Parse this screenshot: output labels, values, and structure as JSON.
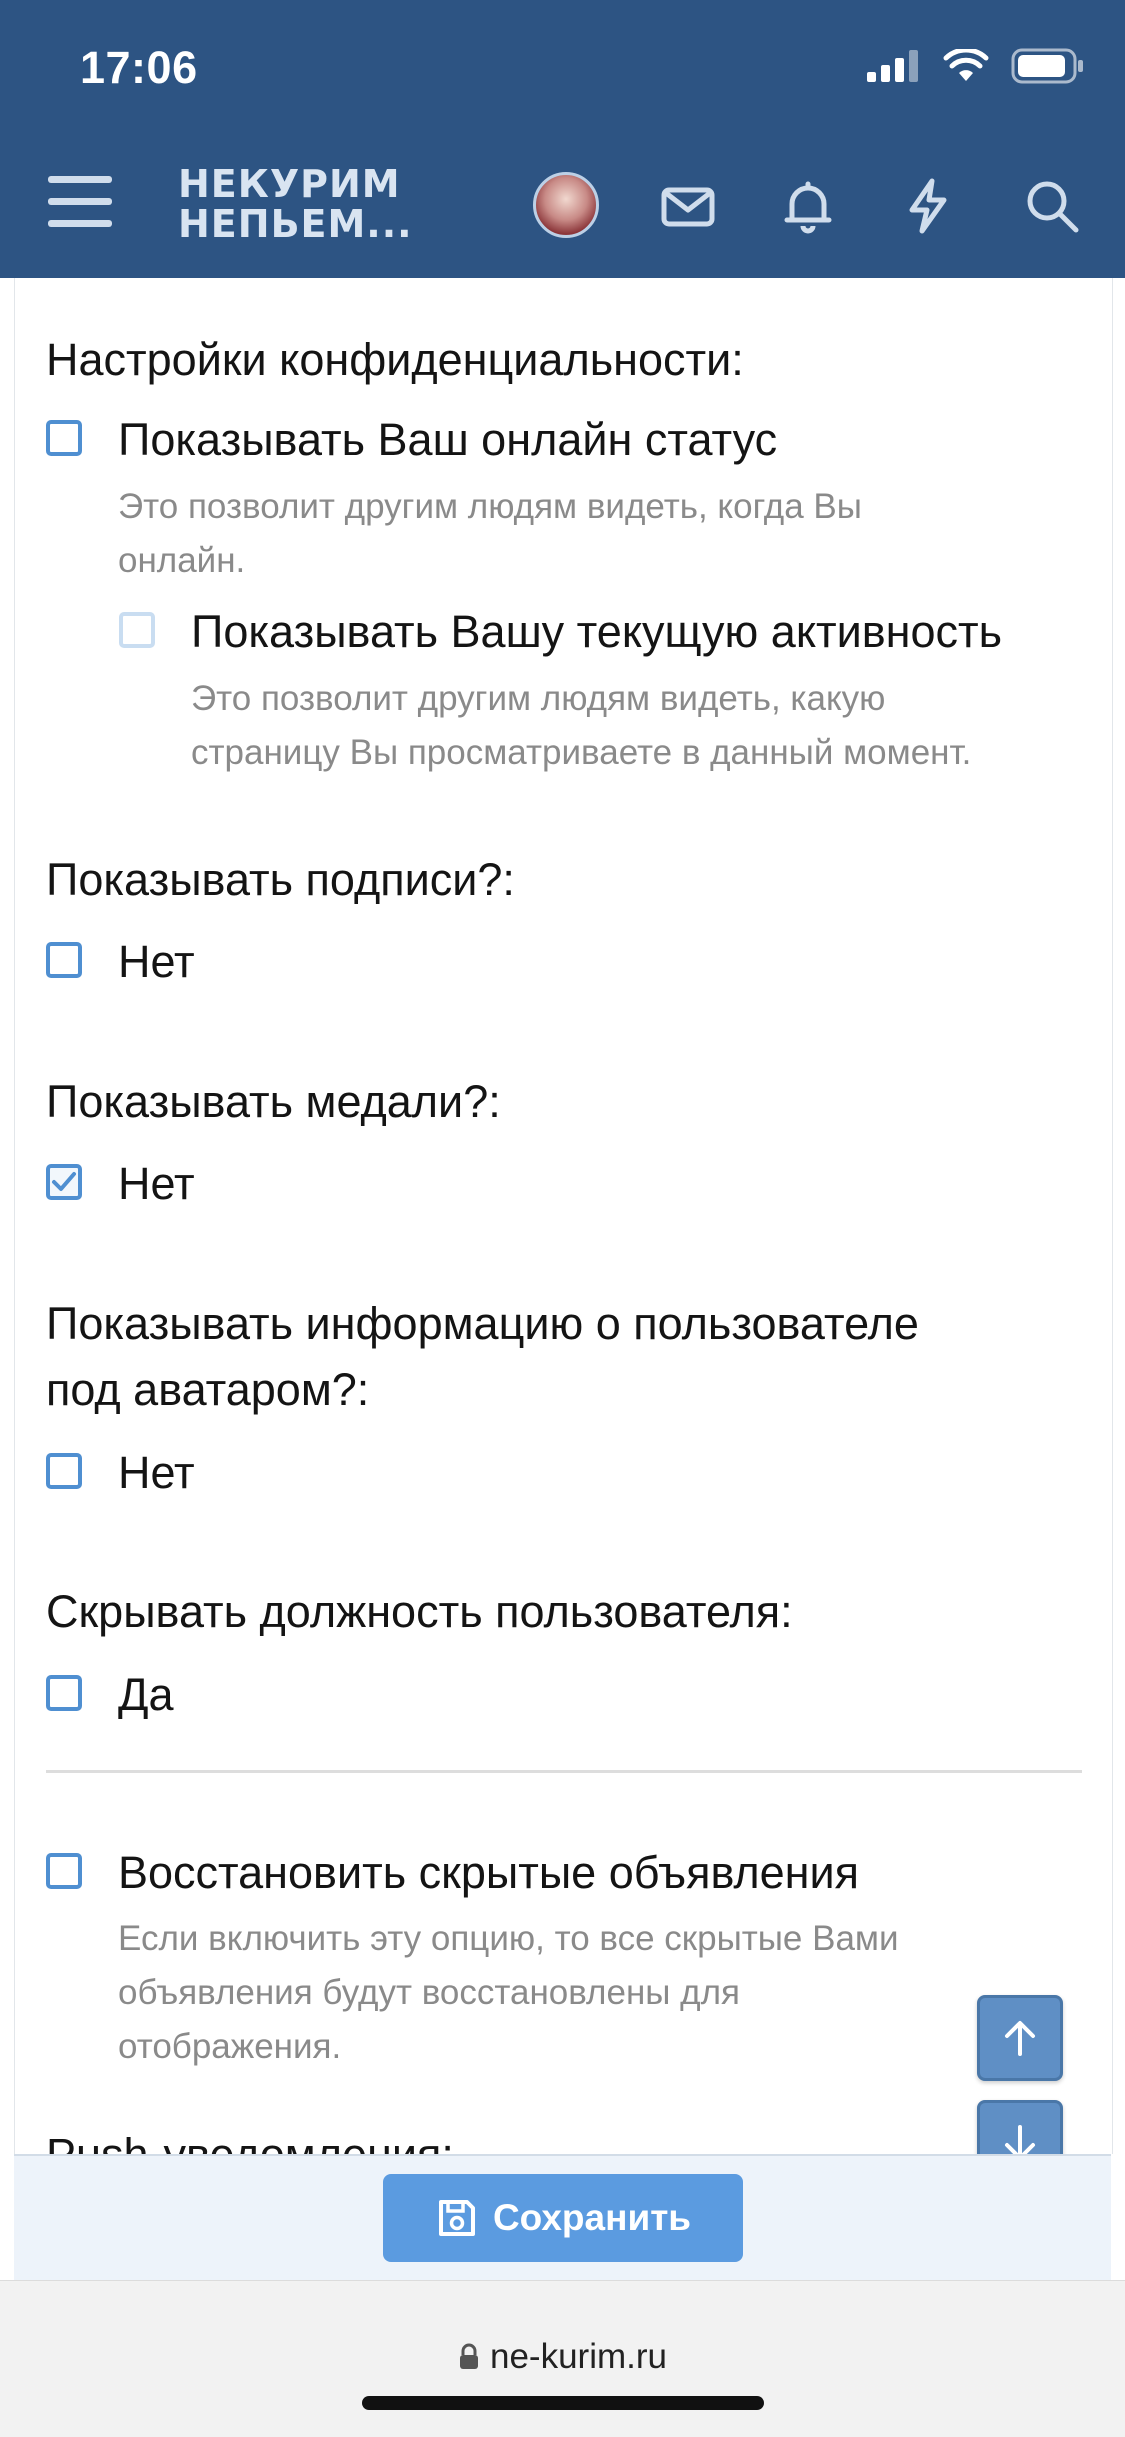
{
  "status_bar": {
    "time": "17:06"
  },
  "header": {
    "logo_line1": "НЕКУРИМ",
    "logo_line2": "НЕПЬЕМ...",
    "icons": [
      "menu-icon",
      "avatar",
      "mail-icon",
      "bell-icon",
      "bolt-icon",
      "search-icon"
    ]
  },
  "privacy": {
    "heading": "Настройки конфиденциальности:",
    "online_status": {
      "label": "Показывать Ваш онлайн статус",
      "hint1": "Это позволит другим людям видеть, когда Вы",
      "hint2": "онлайн.",
      "checked": false
    },
    "activity": {
      "label": "Показывать Вашу текущую активность",
      "hint1": "Это позволит другим людям видеть, какую",
      "hint2": "страницу Вы просматриваете в данный момент.",
      "checked": false,
      "disabled": true
    }
  },
  "signatures": {
    "heading": "Показывать подписи?:",
    "option": "Нет",
    "checked": false
  },
  "medals": {
    "heading": "Показывать медали?:",
    "option": "Нет",
    "checked": true
  },
  "user_info": {
    "heading1": "Показывать информацию о пользователе",
    "heading2": "под аватаром?:",
    "option": "Нет",
    "checked": false
  },
  "hide_title": {
    "heading": "Скрывать должность пользователя:",
    "option": "Да",
    "checked": false
  },
  "restore_notices": {
    "label": "Восстановить скрытые объявления",
    "hint1": "Если включить эту опцию, то все скрытые Вами",
    "hint2": "объявления будут восстановлены для",
    "hint3": "отображения.",
    "checked": false
  },
  "push": {
    "heading": "Push-уведомления:"
  },
  "actions": {
    "save_label": "Сохранить"
  },
  "browser": {
    "url": "ne-kurim.ru"
  },
  "colors": {
    "header_bg": "#2d5483",
    "checkbox_border": "#4f8fd1",
    "save_button": "#5b9be0",
    "hint_text": "#8a8a8a"
  }
}
